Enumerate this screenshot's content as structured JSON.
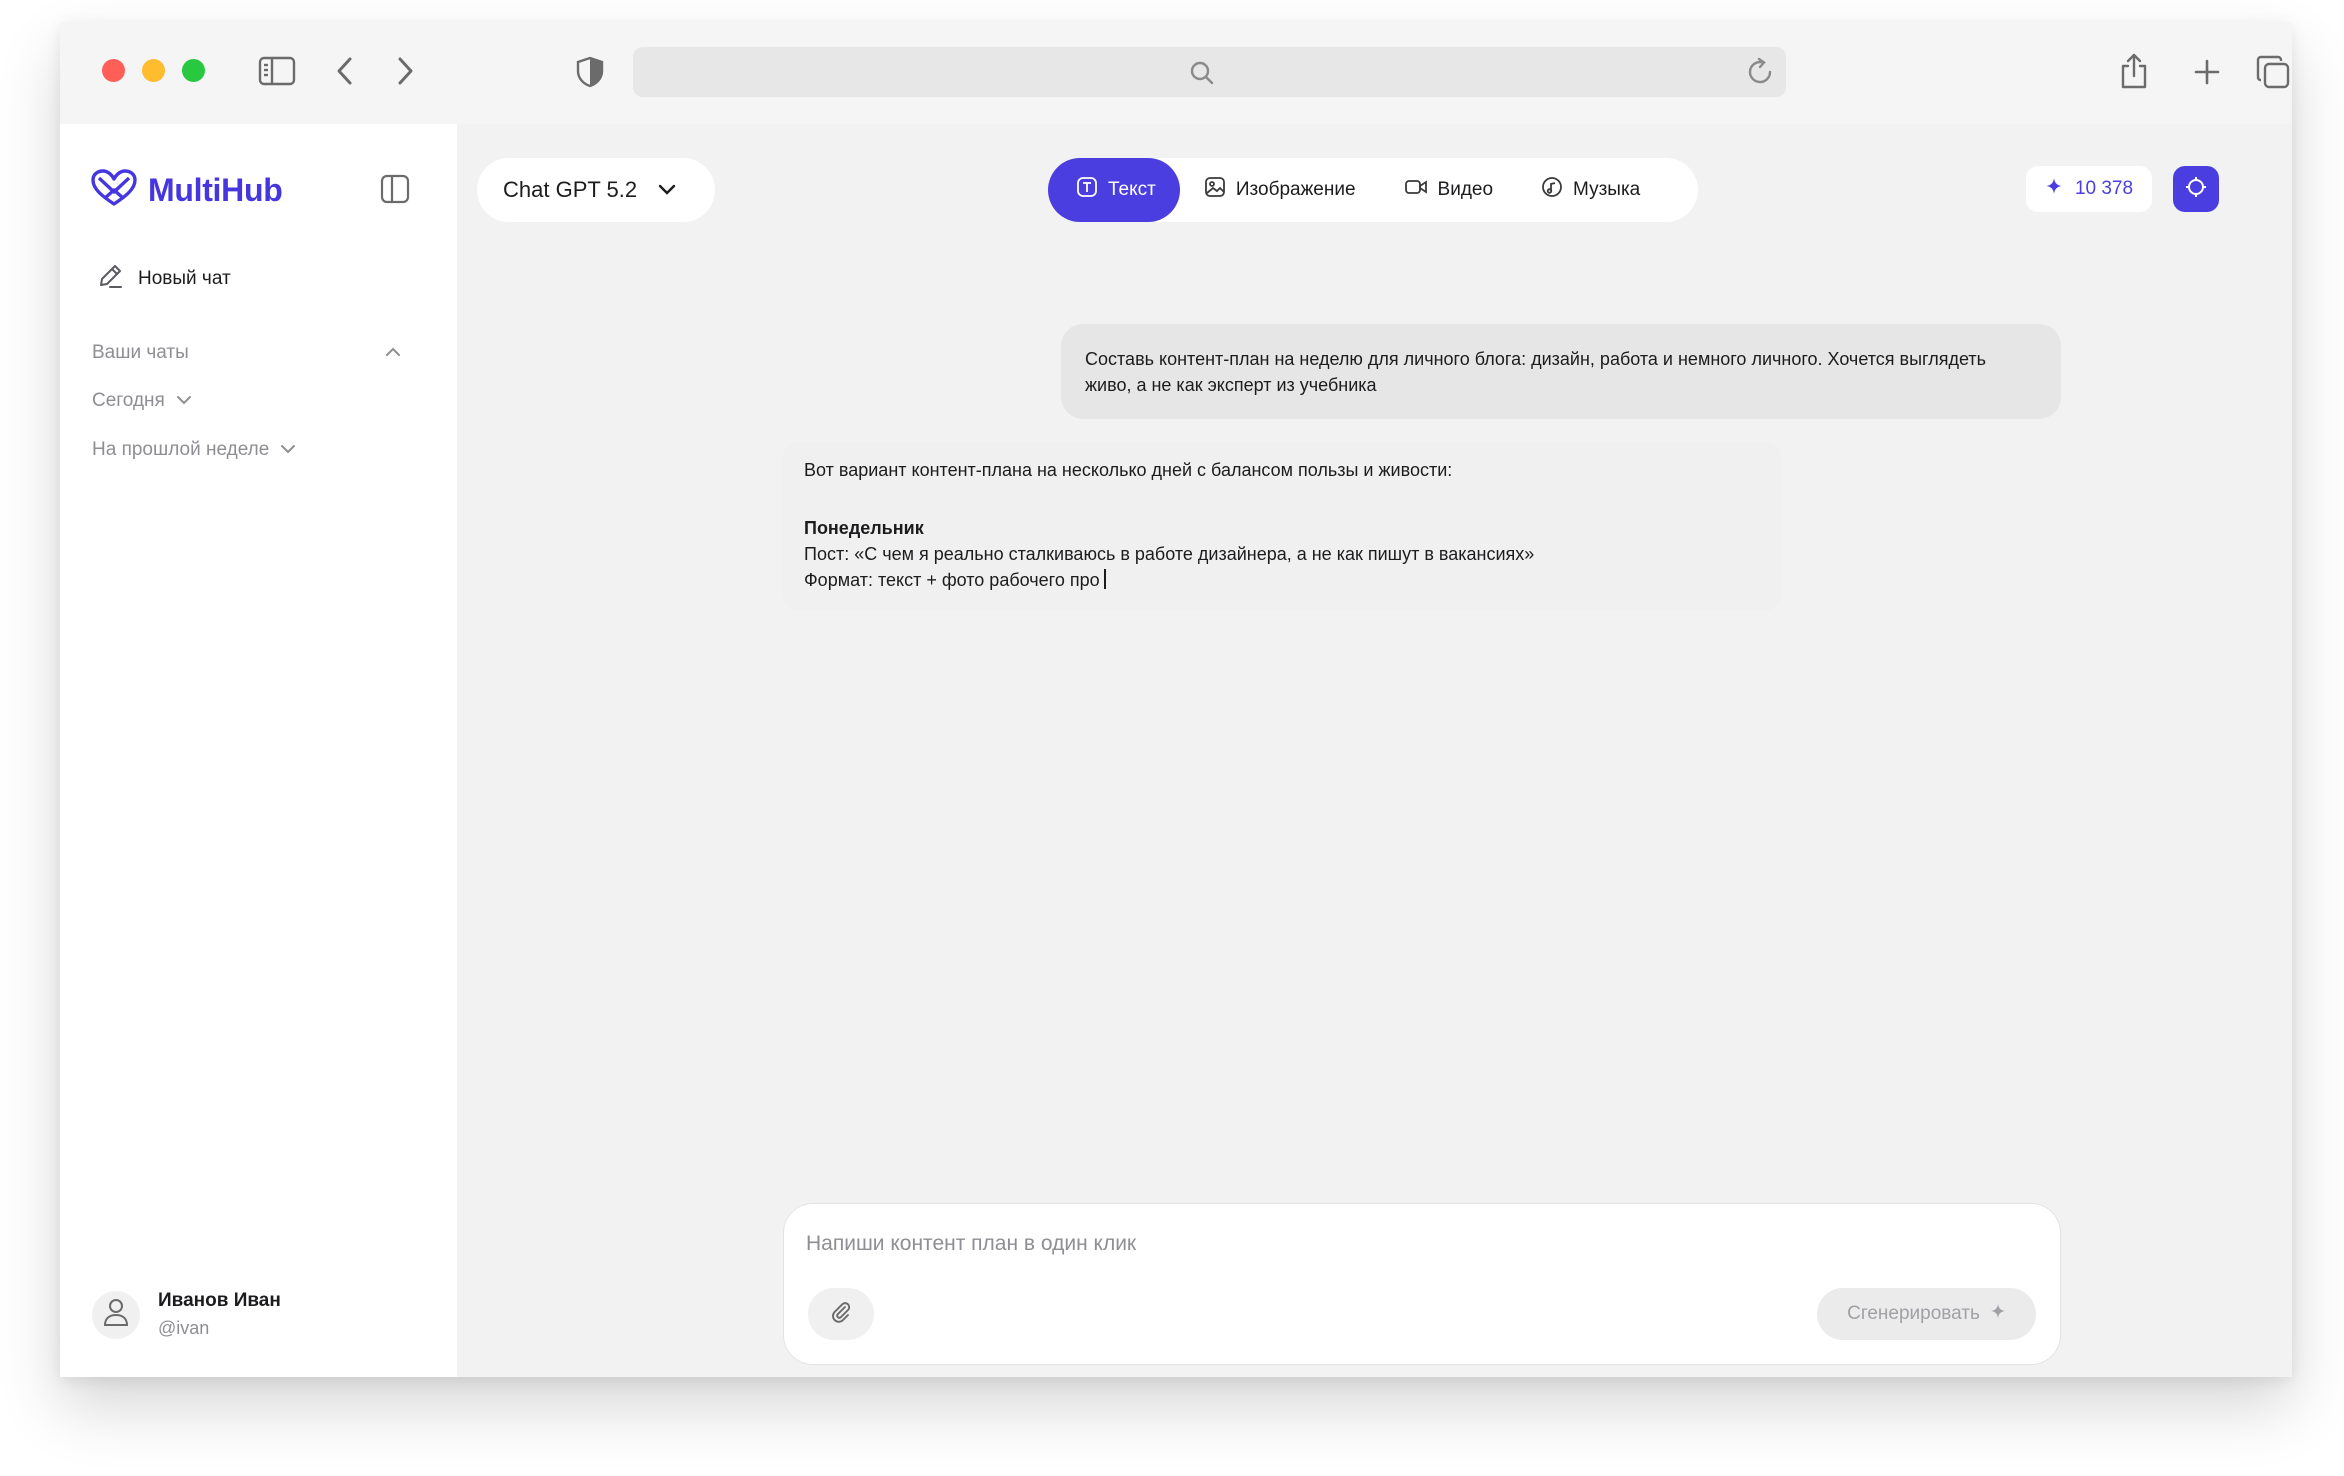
{
  "colors": {
    "accent": "#4a3ee0",
    "logo": "#4536e0",
    "traffic_red": "#ff5f57",
    "traffic_yellow": "#febc2e",
    "traffic_green": "#28c840"
  },
  "browser": {
    "address_value": "",
    "icons": [
      "sidebar-toggle-icon",
      "back-icon",
      "forward-icon",
      "shield-icon",
      "search-icon",
      "reload-icon",
      "share-icon",
      "new-tab-icon",
      "tabs-overview-icon"
    ]
  },
  "sidebar": {
    "logo_text": "MultiHub",
    "new_chat_label": "Новый чат",
    "your_chats_label": "Ваши чаты",
    "groups": [
      {
        "label": "Сегодня"
      },
      {
        "label": "На прошлой неделе"
      }
    ],
    "profile": {
      "name": "Иванов Иван",
      "handle": "@ivan"
    }
  },
  "header": {
    "model_label": "Chat GPT 5.2",
    "modes": [
      {
        "label": "Текст",
        "icon": "text-icon",
        "active": true
      },
      {
        "label": "Изображение",
        "icon": "image-icon",
        "active": false
      },
      {
        "label": "Видео",
        "icon": "video-icon",
        "active": false
      },
      {
        "label": "Музыка",
        "icon": "music-icon",
        "active": false
      }
    ],
    "credits": "10 378"
  },
  "chat": {
    "user_message": "Составь контент-план на неделю для личного блога: дизайн, работа и немного личного. Хочется выглядеть живо, а не как эксперт из учебника",
    "assistant": {
      "intro": "Вот вариант контент-плана на несколько дней с балансом пользы и живости:",
      "day_title": "Понедельник",
      "post_line": "Пост: «С чем я реально сталкиваюсь в работе дизайнера, а не как пишут в вакансиях»",
      "format_line": "Формат: текст + фото рабочего про"
    }
  },
  "composer": {
    "value": "",
    "placeholder": "Напиши контент план в один клик",
    "generate_label": "Сгенерировать"
  }
}
